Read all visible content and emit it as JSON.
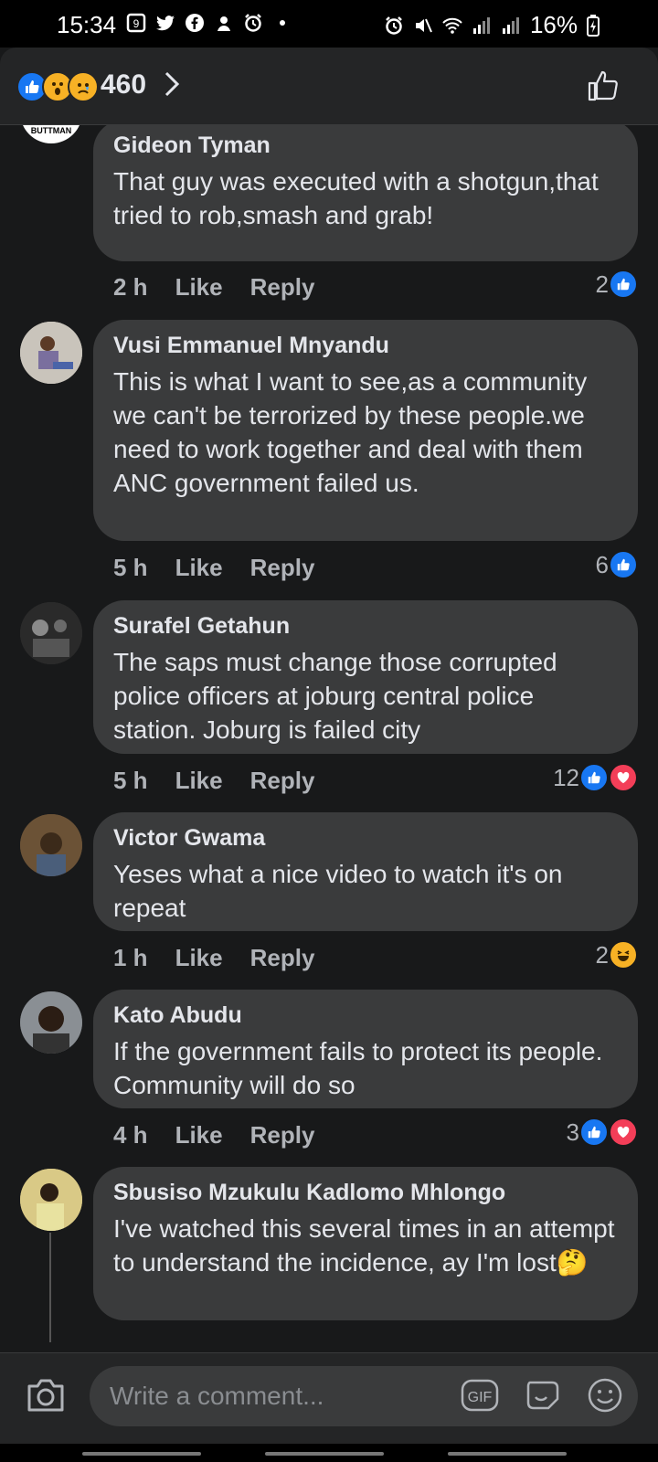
{
  "status_bar": {
    "time": "15:34",
    "battery": "16%"
  },
  "header": {
    "reaction_count": "460"
  },
  "comments": [
    {
      "author": "Gideon Tyman",
      "avatar_text": "BUTTMAN",
      "text": "That guy was executed with a shotgun,that tried to rob,smash and grab!",
      "time": "2 h",
      "like": "Like",
      "reply": "Reply",
      "reaction_count": "2",
      "reactions": [
        "like"
      ]
    },
    {
      "author": "Vusi Emmanuel Mnyandu",
      "text": "This is what I want to see,as a community we can't be terrorized by these people.we need to work together and deal with them ANC government failed us.",
      "time": "5 h",
      "like": "Like",
      "reply": "Reply",
      "reaction_count": "6",
      "reactions": [
        "like"
      ]
    },
    {
      "author": "Surafel Getahun",
      "text": "The saps must change those corrupted police officers at joburg central police station. Joburg is failed city",
      "time": "5 h",
      "like": "Like",
      "reply": "Reply",
      "reaction_count": "12",
      "reactions": [
        "like",
        "love"
      ]
    },
    {
      "author": "Victor Gwama",
      "text": "Yeses what a nice video to watch it's on repeat",
      "time": "1 h",
      "like": "Like",
      "reply": "Reply",
      "reaction_count": "2",
      "reactions": [
        "haha"
      ]
    },
    {
      "author": "Kato Abudu",
      "text": "If the government fails to protect  its people. Community will do so",
      "time": "4 h",
      "like": "Like",
      "reply": "Reply",
      "reaction_count": "3",
      "reactions": [
        "like",
        "love"
      ]
    },
    {
      "author": "Sbusiso Mzukulu Kadlomo Mhlongo",
      "text": "I've watched this several times in an attempt to understand the incidence, ay I'm lost",
      "emoji": "🤔"
    }
  ],
  "composer": {
    "placeholder": "Write a comment...",
    "gif_label": "GIF"
  },
  "colors": {
    "like_blue": "#1877f2",
    "love_red": "#f33e58",
    "haha_yellow": "#f7b125",
    "bubble": "#3a3b3c",
    "background": "#18191a"
  }
}
